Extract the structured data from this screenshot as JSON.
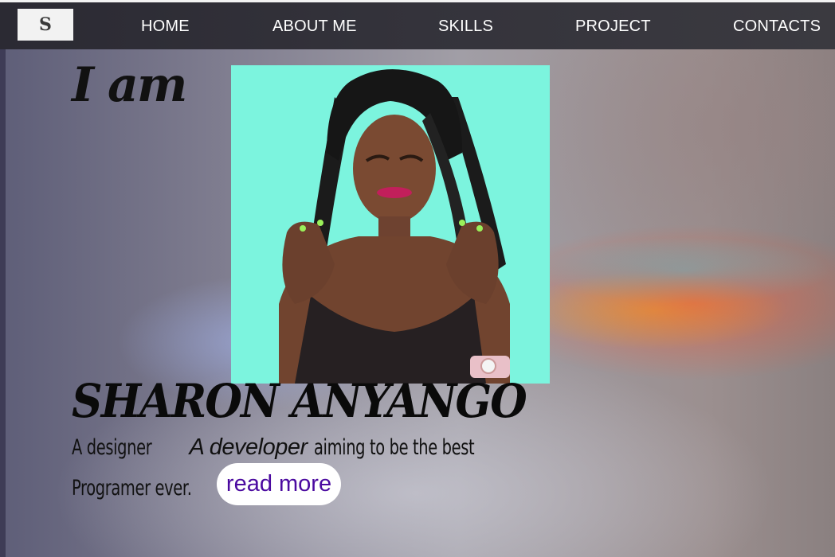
{
  "logo": {
    "letter": "S"
  },
  "nav": {
    "items": [
      {
        "label": "HOME"
      },
      {
        "label": "ABOUT ME"
      },
      {
        "label": "SKILLS"
      },
      {
        "label": "PROJECT"
      },
      {
        "label": "CONTACTS"
      }
    ]
  },
  "hero": {
    "intro": "I am",
    "name": "SHARON ANYANGO",
    "tagline_part1": "A designer",
    "tagline_part2": "A developer",
    "tagline_part3": "aiming to be the best",
    "tagline_part4": "Programer ever.",
    "read_more_label": "read more",
    "photo_background": "#7cf4de",
    "button_text_color": "#4b0aa0"
  }
}
